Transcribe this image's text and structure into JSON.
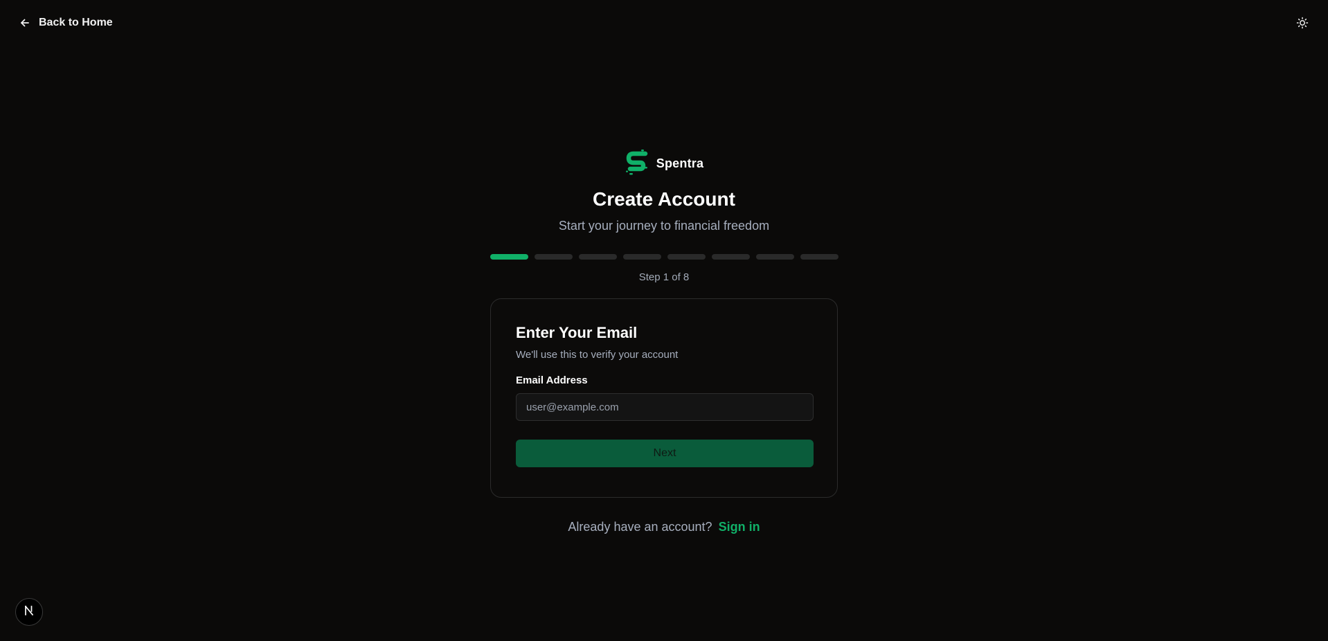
{
  "header": {
    "back_label": "Back to Home",
    "back_icon": "arrow-left-icon",
    "theme_icon": "sun-icon"
  },
  "brand": {
    "name": "Spentra",
    "logo_icon": "spentra-s-logo",
    "accent_color": "#10b068"
  },
  "page": {
    "title": "Create Account",
    "subtitle": "Start your journey to financial freedom"
  },
  "progress": {
    "current_step": 1,
    "total_steps": 8,
    "label": "Step 1 of 8",
    "active_color": "#10b068",
    "inactive_color": "#2a2a2a"
  },
  "card": {
    "title": "Enter Your Email",
    "description": "We'll use this to verify your account",
    "email_label": "Email Address",
    "email_placeholder": "user@example.com",
    "email_value": "",
    "next_label": "Next"
  },
  "footer": {
    "prompt": "Already have an account?",
    "signin_label": "Sign in"
  },
  "dev_badge": {
    "letter": "N",
    "icon": "nextjs-icon"
  }
}
